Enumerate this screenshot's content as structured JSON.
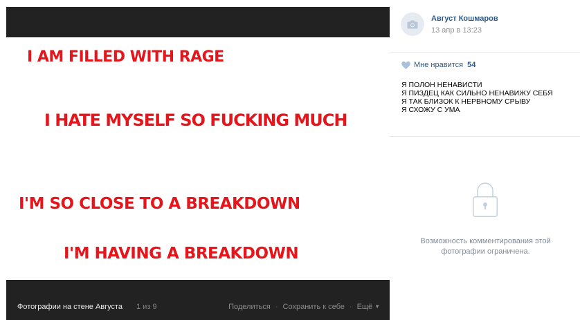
{
  "photo": {
    "lines": [
      "I AM FILLED WITH RAGE",
      "I HATE MYSELF SO FUCKING MUCH",
      "I'M SO CLOSE TO A BREAKDOWN",
      "I'M HAVING A BREAKDOWN"
    ],
    "text_color": "#e4161b"
  },
  "viewer_bar": {
    "album_title": "Фотографии на стене Августа",
    "counter": "1 из 9",
    "share_label": "Поделиться",
    "save_label": "Сохранить к себе",
    "more_label": "Ещё"
  },
  "post": {
    "author": "Август Кошмаров",
    "date": "13 апр в 13:23",
    "like_label": "Мне нравится",
    "like_count": "54",
    "caption_lines": [
      "Я ПОЛОН НЕНАВИСТИ",
      "Я ПИЗДЕЦ КАК СИЛЬНО НЕНАВИЖУ СЕБЯ",
      "Я ТАК БЛИЗОК К НЕРВНОМУ СРЫВУ",
      "Я СХОЖУ С УМА"
    ],
    "comments_restricted": "Возможность комментирования этой фотографии ограничена."
  },
  "colors": {
    "link": "#2a5885",
    "dark_bar": "#222222",
    "muted": "#818c99"
  }
}
